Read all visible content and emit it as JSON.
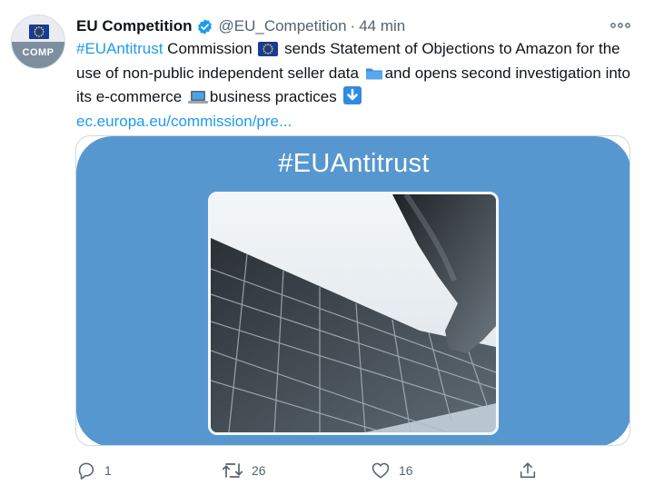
{
  "tweet": {
    "avatar_label": "COMP",
    "display_name": "EU Competition",
    "handle": "@EU_Competition",
    "separator": "·",
    "time": "44 min",
    "text": {
      "hashtag": "#EUAntitrust",
      "part1": " Commission ",
      "part2": " sends Statement of Objections to Amazon for the use of non-public independent seller data ",
      "part3": "and opens second investigation into its e-commerce ",
      "part4": "business practices ",
      "link": "ec.europa.eu/commission/pre..."
    },
    "media": {
      "banner_text": "#EUAntitrust"
    },
    "actions": {
      "reply_count": "1",
      "retweet_count": "26",
      "like_count": "16"
    }
  },
  "colors": {
    "link": "#1d9bf0",
    "muted": "#536471",
    "banner": "#5797d0",
    "verified": "#1d9bf0"
  },
  "icons": [
    "eu-flag-icon",
    "verified-badge-icon",
    "more-icon",
    "folder-icon",
    "laptop-icon",
    "down-arrow-icon",
    "reply-icon",
    "retweet-icon",
    "like-icon",
    "share-icon"
  ]
}
